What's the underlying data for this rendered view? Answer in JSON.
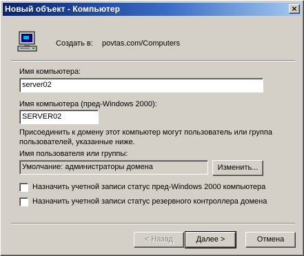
{
  "window": {
    "title": "Новый объект - Компьютер",
    "close_glyph": "×"
  },
  "header": {
    "create_in_label": "Создать в:",
    "create_in_path": "povtas.com/Computers",
    "icon": "computer-icon"
  },
  "form": {
    "computer_name_label": "Имя компьютера:",
    "computer_name_value": "server02",
    "pre2000_label": "Имя компьютера (пред-Windows 2000):",
    "pre2000_value": "SERVER02",
    "join_text": "Присоединить к домену этот компьютер могут пользователь или группа пользователей, указанные ниже.",
    "user_group_label": "Имя пользователя или группы:",
    "user_group_value": "Умолчание: администраторы домена",
    "change_button": "Изменить...",
    "checkbox_pre2000": "Назначить учетной записи статус пред-Windows 2000 компьютера",
    "checkbox_pre2000_checked": false,
    "checkbox_bdc": "Назначить учетной записи статус резервного контроллера домена",
    "checkbox_bdc_checked": false
  },
  "footer": {
    "back_button": "< Назад",
    "next_button": "Далее >",
    "cancel_button": "Отмена"
  }
}
